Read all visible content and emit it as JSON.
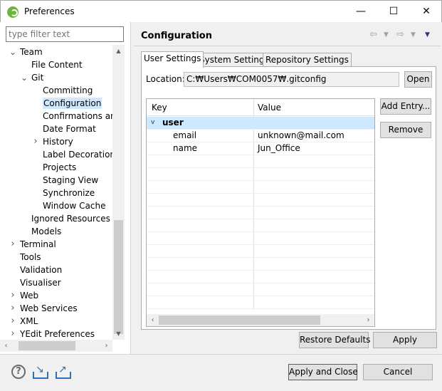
{
  "window": {
    "title": "Preferences",
    "minimize": "—",
    "maximize": "☐",
    "close": "✕"
  },
  "filter": {
    "placeholder": "type filter text"
  },
  "tree": [
    {
      "label": "Team",
      "level": 1,
      "toggle": "v"
    },
    {
      "label": "File Content",
      "level": 2,
      "toggle": ""
    },
    {
      "label": "Git",
      "level": 2,
      "toggle": "v"
    },
    {
      "label": "Committing",
      "level": 3,
      "toggle": ""
    },
    {
      "label": "Configuration",
      "level": 3,
      "toggle": "",
      "selected": true
    },
    {
      "label": "Confirmations and",
      "level": 3,
      "toggle": ""
    },
    {
      "label": "Date Format",
      "level": 3,
      "toggle": ""
    },
    {
      "label": "History",
      "level": 3,
      "toggle": ">"
    },
    {
      "label": "Label Decorations",
      "level": 3,
      "toggle": ""
    },
    {
      "label": "Projects",
      "level": 3,
      "toggle": ""
    },
    {
      "label": "Staging View",
      "level": 3,
      "toggle": ""
    },
    {
      "label": "Synchronize",
      "level": 3,
      "toggle": ""
    },
    {
      "label": "Window Cache",
      "level": 3,
      "toggle": ""
    },
    {
      "label": "Ignored Resources",
      "level": 2,
      "toggle": ""
    },
    {
      "label": "Models",
      "level": 2,
      "toggle": ""
    },
    {
      "label": "Terminal",
      "level": 1,
      "toggle": ">"
    },
    {
      "label": "Tools",
      "level": 1,
      "toggle": ""
    },
    {
      "label": "Validation",
      "level": 1,
      "toggle": ""
    },
    {
      "label": "Visualiser",
      "level": 1,
      "toggle": ""
    },
    {
      "label": "Web",
      "level": 1,
      "toggle": ">"
    },
    {
      "label": "Web Services",
      "level": 1,
      "toggle": ">"
    },
    {
      "label": "XML",
      "level": 1,
      "toggle": ">"
    },
    {
      "label": "YEdit Preferences",
      "level": 1,
      "toggle": ">"
    }
  ],
  "page": {
    "title": "Configuration"
  },
  "tabs": [
    {
      "label": "User Settings",
      "active": true
    },
    {
      "label": "System Settings",
      "active": false
    },
    {
      "label": "Repository Settings",
      "active": false
    }
  ],
  "location": {
    "label": "Location:",
    "value": "C:₩Users₩COM0057₩.gitconfig",
    "open_button": "Open"
  },
  "table": {
    "columns": [
      "Key",
      "Value"
    ],
    "group": "user",
    "rows": [
      {
        "key": "email",
        "value": "unknown@mail.com"
      },
      {
        "key": "name",
        "value": "Jun_Office"
      }
    ]
  },
  "buttons": {
    "add_entry": "Add Entry...",
    "remove": "Remove",
    "restore_defaults": "Restore Defaults",
    "apply": "Apply",
    "apply_and_close": "Apply and Close",
    "cancel": "Cancel"
  },
  "icons": {
    "help": "?",
    "import": "import-icon",
    "export": "export-icon"
  }
}
